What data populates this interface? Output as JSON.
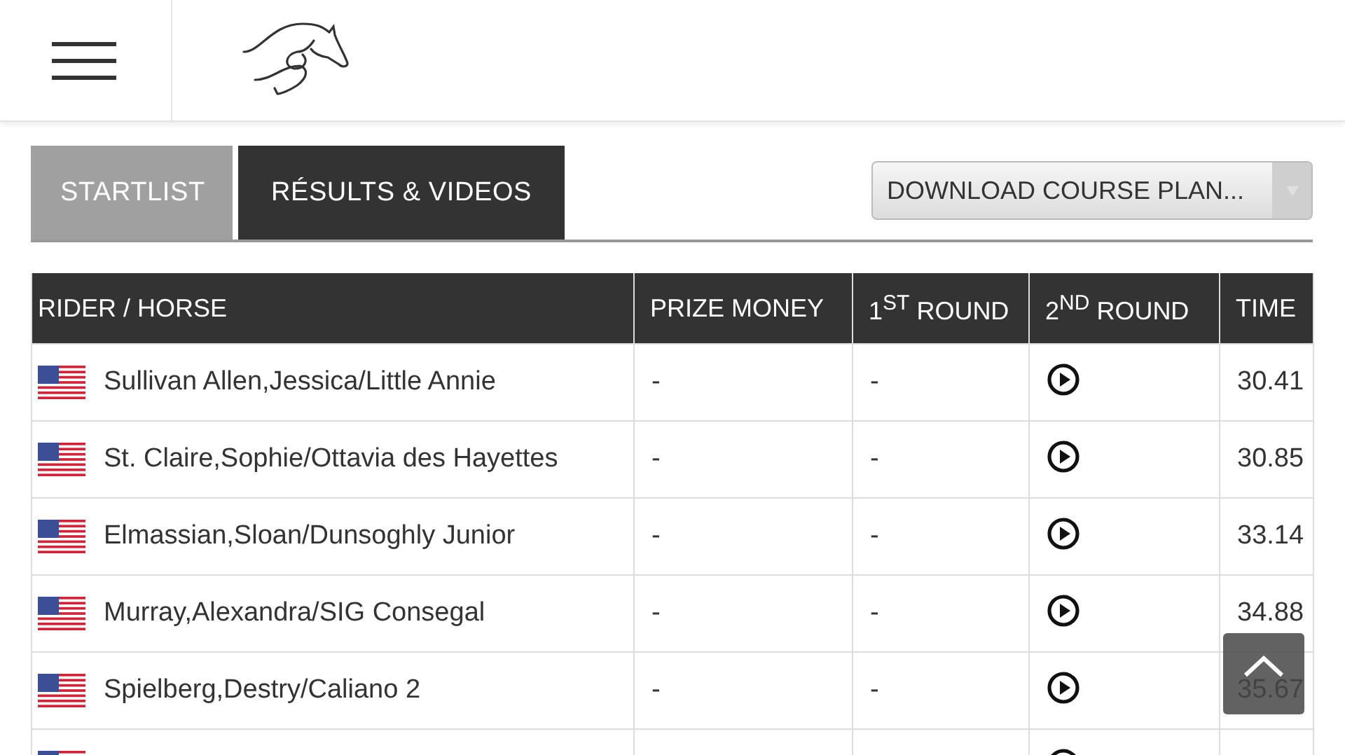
{
  "tabs": [
    {
      "label": "STARTLIST",
      "selected": false
    },
    {
      "label": "RÉSULTS & VIDEOS",
      "selected": true
    }
  ],
  "course_plan_dropdown": {
    "value": "DOWNLOAD COURSE PLAN..."
  },
  "table": {
    "columns": [
      "RIDER / HORSE",
      "PRIZE MONEY",
      "1$^{ST}$ ROUND",
      "2$^{ND}$ ROUND",
      "TIME"
    ],
    "rows": [
      {
        "kind": "entry",
        "rider_horse": "Sullivan Allen,Jessica/Little Annie",
        "prize_money": "-",
        "round_1": "-",
        "time": "30.41"
      },
      {
        "kind": "entry",
        "rider_horse": "St. Claire,Sophie/Ottavia des Hayettes",
        "prize_money": "-",
        "round_1": "-",
        "time": "30.85"
      },
      {
        "kind": "entry",
        "rider_horse": "Elmassian,Sloan/Dunsoghly Junior",
        "prize_money": "-",
        "round_1": "-",
        "time": "33.14"
      },
      {
        "kind": "entry",
        "rider_horse": "Murray,Alexandra/SIG Consegal",
        "prize_money": "-",
        "round_1": "-",
        "time": "34.88"
      },
      {
        "kind": "entry",
        "rider_horse": "Spielberg,Destry/Caliano 2",
        "prize_money": "-",
        "round_1": "-",
        "time": "35.67"
      },
      {
        "kind": "partial"
      }
    ]
  }
}
